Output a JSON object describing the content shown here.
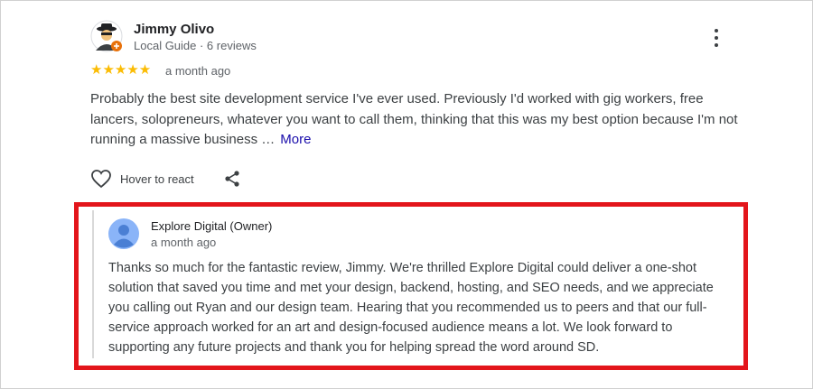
{
  "review": {
    "reviewer_name": "Jimmy Olivo",
    "reviewer_meta": "Local Guide · 6 reviews",
    "rating_stars": "★★★★★",
    "rating": 5,
    "date": "a month ago",
    "text": "Probably the best site development service I've ever used. Previously I'd worked with gig workers, free lancers, solopreneurs, whatever you want to call them, thinking that this was my best option because I'm not running a massive business …",
    "more_label": "More",
    "react_label": "Hover to react"
  },
  "owner_response": {
    "name": "Explore Digital (Owner)",
    "date": "a month ago",
    "text": "Thanks so much for the fantastic review, Jimmy. We're thrilled Explore Digital could deliver a one-shot solution that saved you time and met your design, backend, hosting, and SEO needs, and we appreciate you calling out Ryan and our design team. Hearing that you recommended us to peers and that our full-service approach worked for an art and design-focused audience means a lot. We look forward to supporting any future projects and thank you for helping spread the word around SD."
  },
  "colors": {
    "highlight": "#e3151b",
    "stars": "#fbbc04",
    "link": "#1a0dab",
    "owner_avatar": "#8ab4f8"
  },
  "icons": {
    "menu": "more-vert-icon",
    "react": "heart-outline-icon",
    "share": "share-icon",
    "reviewer_avatar": "detective-avatar-icon",
    "owner_avatar": "default-user-avatar-icon"
  }
}
